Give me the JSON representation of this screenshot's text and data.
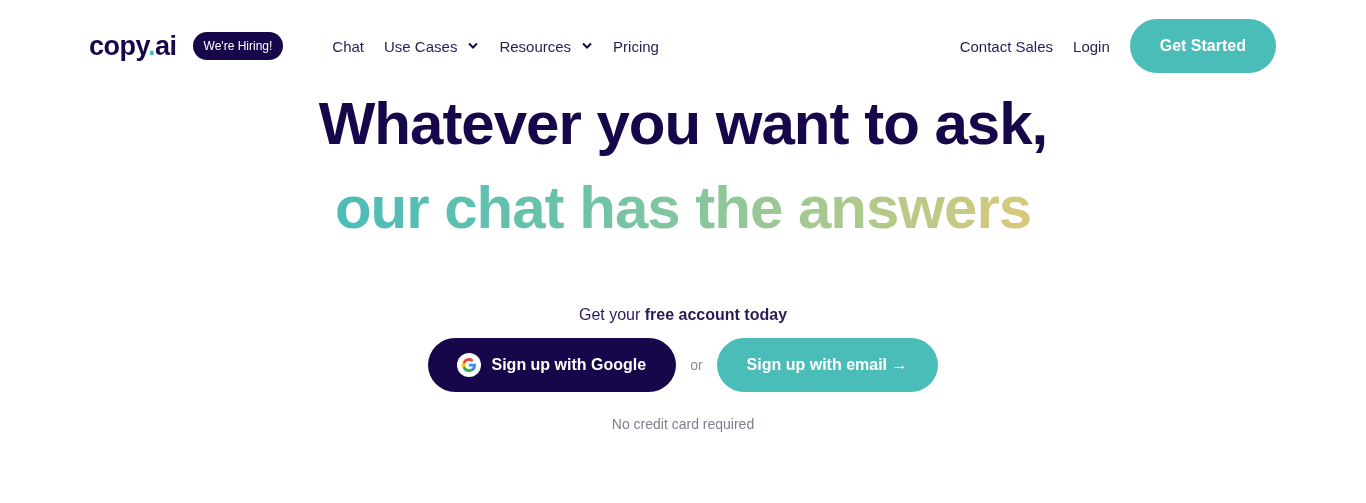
{
  "header": {
    "logo": {
      "parts": [
        "copy",
        ".",
        "ai"
      ]
    },
    "badge": "We're Hiring!",
    "nav": [
      {
        "label": "Chat",
        "kind": "link"
      },
      {
        "label": "Use Cases",
        "kind": "dropdown"
      },
      {
        "label": "Resources",
        "kind": "dropdown"
      },
      {
        "label": "Pricing",
        "kind": "link"
      }
    ],
    "right_links": [
      "Contact Sales",
      "Login"
    ],
    "cta": "Get Started"
  },
  "hero": {
    "headline": "Whatever you want to ask,",
    "headline_accent": "our chat has the answers",
    "subtitle": "Get your **free account today**",
    "google_button": "Sign up with Google",
    "separator": "or",
    "email_button": "Sign up with email →",
    "note": "No credit card required"
  }
}
